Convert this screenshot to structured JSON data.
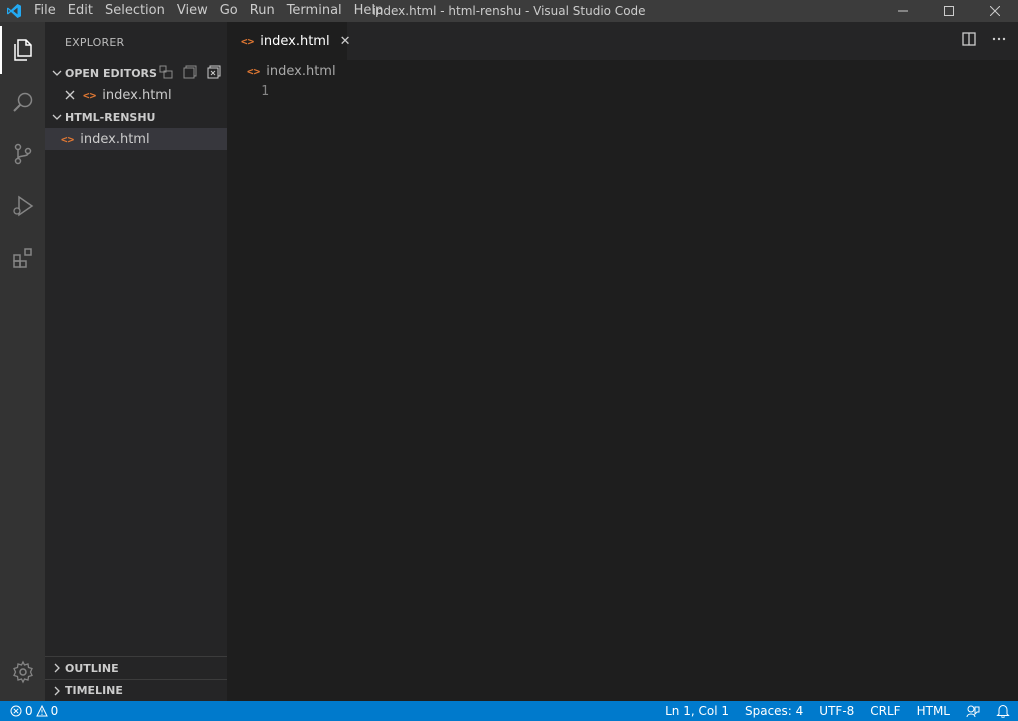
{
  "titlebar": {
    "menu": [
      "File",
      "Edit",
      "Selection",
      "View",
      "Go",
      "Run",
      "Terminal",
      "Help"
    ],
    "window_title": "index.html - html-renshu - Visual Studio Code"
  },
  "activitybar": {
    "items": [
      "explorer",
      "search",
      "source-control",
      "run-debug",
      "extensions"
    ],
    "active": "explorer"
  },
  "sidebar": {
    "title": "EXPLORER",
    "open_editors": {
      "label": "OPEN EDITORS",
      "files": [
        {
          "name": "index.html",
          "icon": "<>"
        }
      ]
    },
    "folder": {
      "label": "HTML-RENSHU",
      "files": [
        {
          "name": "index.html",
          "icon": "<>"
        }
      ]
    },
    "outline_label": "OUTLINE",
    "timeline_label": "TIMELINE"
  },
  "editor": {
    "tab": {
      "label": "index.html",
      "icon": "<>",
      "close": "✕"
    },
    "breadcrumb": {
      "label": "index.html",
      "icon": "<>"
    },
    "lines": [
      {
        "number": "1",
        "text": ""
      }
    ]
  },
  "statusbar": {
    "errors": "0",
    "warnings": "0",
    "position": "Ln 1, Col 1",
    "spaces": "Spaces: 4",
    "encoding": "UTF-8",
    "eol": "CRLF",
    "language": "HTML"
  },
  "colors": {
    "accent": "#007acc",
    "html_icon": "#e37933",
    "vscode_logo": "#23a9f2"
  }
}
